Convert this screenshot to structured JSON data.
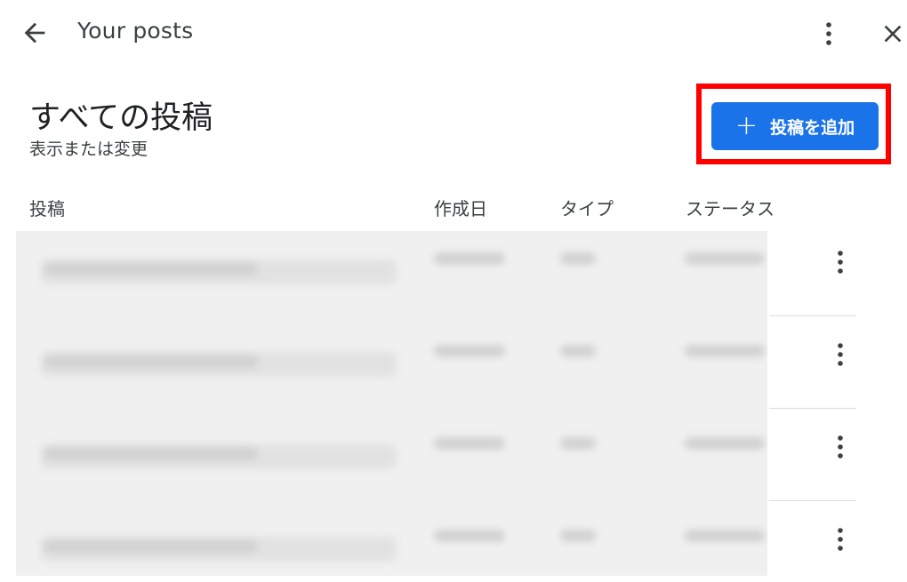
{
  "header": {
    "title": "Your posts",
    "icons": {
      "back": "arrow-back-icon",
      "more": "more-vert-icon",
      "close": "close-icon"
    }
  },
  "page": {
    "title": "すべての投稿",
    "subtitle": "表示または変更"
  },
  "add_button": {
    "icon": "plus-icon",
    "label": "投稿を追加",
    "color": "#1a73e8",
    "highlight_color": "#ff0000"
  },
  "table": {
    "columns": [
      "投稿",
      "作成日",
      "タイプ",
      "ステータス"
    ],
    "rows": [
      {},
      {},
      {},
      {}
    ],
    "row_action_icon": "more-vert-icon"
  }
}
